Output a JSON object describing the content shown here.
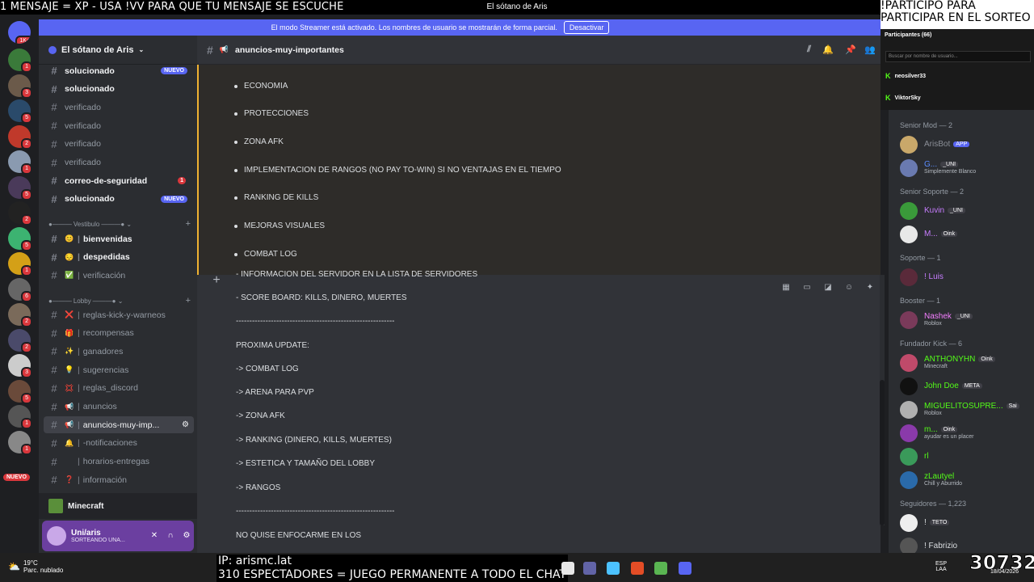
{
  "overlay": {
    "marquee": "1 MENSAJE = XP - USA !VV PARA QUE TU MENSAJE SE ESCUCHE",
    "window_title": "El sótano de Aris",
    "right_text": "!PARTICIPO PARA PARTICIPAR EN EL SORTEO",
    "ip": "IP: arismc.lat",
    "spectators": "310 ESPECTADORES = JUEGO PERMANENTE A TODO EL CHAT",
    "viewer_count": "30732"
  },
  "banner": {
    "text": "El modo Streamer está activado. Los nombres de usuario se mostrarán de forma parcial.",
    "button": "Desactivar"
  },
  "rail": {
    "home_badge": "1K+",
    "badges": [
      "1",
      "3",
      "5",
      "2",
      "1",
      "5",
      "2",
      "5",
      "1",
      "6",
      "2",
      "2",
      "3",
      "5",
      "1",
      "1"
    ],
    "new_label": "NUEVO"
  },
  "server": {
    "name": "El sótano de Aris"
  },
  "channels": [
    {
      "name": "solucionado",
      "unread": true,
      "badge": "NUEVO"
    },
    {
      "name": "solucionado",
      "unread": true
    },
    {
      "name": "verificado"
    },
    {
      "name": "verificado"
    },
    {
      "name": "verificado"
    },
    {
      "name": "verificado"
    },
    {
      "name": "correo-de-seguridad",
      "unread": true,
      "count": "1"
    },
    {
      "name": "solucionado",
      "unread": true,
      "badge": "NUEVO"
    }
  ],
  "category_vestibulo": "Vestibulo",
  "vestibulo_channels": [
    {
      "emoji": "😊",
      "name": "bienvenidas"
    },
    {
      "emoji": "😔",
      "name": "despedidas"
    },
    {
      "emoji": "✅",
      "name": "verificación"
    }
  ],
  "category_lobby": "Lobby",
  "lobby_channels": [
    {
      "emoji": "❌",
      "name": "reglas-kick-y-warneos"
    },
    {
      "emoji": "🎁",
      "name": "recompensas"
    },
    {
      "emoji": "✨",
      "name": "ganadores"
    },
    {
      "emoji": "💡",
      "name": "sugerencias"
    },
    {
      "emoji": "💢",
      "name": "reglas_discord"
    },
    {
      "emoji": "📢",
      "name": "anuncios"
    },
    {
      "emoji": "📢",
      "name": "anuncios-muy-imp..."
    },
    {
      "emoji": "🔔",
      "name": "-notificaciones"
    },
    {
      "emoji": "",
      "name": "horarios-entregas"
    },
    {
      "emoji": "❓",
      "name": "información"
    }
  ],
  "voice": {
    "name": "Minecraft"
  },
  "user": {
    "name": "Uni/aris",
    "status": "SORTEANDO UNA..."
  },
  "channel_header": {
    "name": "anuncios-muy-importantes"
  },
  "thread_bullets": [
    "ECONOMIA",
    "PROTECCIONES",
    "ZONA AFK",
    "IMPLEMENTACION DE RANGOS (NO PAY TO-WIN) SI NO VENTAJAS EN EL TIEMPO",
    "RANKING DE KILLS",
    "MEJORAS VISUALES",
    "COMBAT LOG"
  ],
  "messages": [
    "- INFORMACION DEL SERVIDOR EN LA LISTA DE SERVIDORES",
    "- SCORE BOARD: KILLS, DINERO, MUERTES",
    "-----------------------------------------------------------",
    "PROXIMA UPDATE:",
    "-> COMBAT LOG",
    "-> ARENA PARA PVP",
    "-> ZONA AFK",
    "-> RANKING (DINERO, KILLS, MUERTES)",
    "-> ESTETICA Y TAMAÑO DEL LOBBY",
    "-> RANGOS",
    "-----------------------------------------------------------",
    "NO QUISE ENFOCARME EN LOS"
  ],
  "participants": {
    "title": "Participantes (66)",
    "search_placeholder": "Buscar por nombre de usuario...",
    "list": [
      "neosilver33",
      "ViktorSky"
    ]
  },
  "member_groups": [
    {
      "title": "Senior Mod — 2",
      "members": [
        {
          "name": "ArisBot",
          "tag": "APP",
          "color": "#8b8f97",
          "sub": ""
        },
        {
          "name": "G...",
          "tag": "_UNI",
          "color": "#5b8cff",
          "sub": "Simplemente Blanco"
        }
      ]
    },
    {
      "title": "Senior Soporte — 2",
      "members": [
        {
          "name": "Kuvin",
          "tag": "_UNI",
          "color": "#c77dff",
          "sub": ""
        },
        {
          "name": "M...",
          "tag": "Oink",
          "color": "#c77dff",
          "sub": ""
        }
      ]
    },
    {
      "title": "Soporte — 1",
      "members": [
        {
          "name": "! Luis",
          "tag": "",
          "color": "#c77dff",
          "sub": ""
        }
      ]
    },
    {
      "title": "Booster — 1",
      "members": [
        {
          "name": "Nashek",
          "tag": "_UNI",
          "color": "#f47fff",
          "sub": "Roblox"
        }
      ]
    },
    {
      "title": "Fundador Kick — 6",
      "members": [
        {
          "name": "ANTHONYHN",
          "tag": "Oink",
          "color": "#53fc18",
          "sub": "Minecraft"
        },
        {
          "name": "John Doe",
          "tag": "META",
          "color": "#53fc18",
          "sub": ""
        },
        {
          "name": "MIGUELITOSUPRE...",
          "tag": "Sai",
          "color": "#53fc18",
          "sub": "Roblox"
        },
        {
          "name": "m...",
          "tag": "Oink",
          "color": "#53fc18",
          "sub": "ayudar es un placer"
        },
        {
          "name": "rl",
          "tag": "",
          "color": "#53fc18",
          "sub": ""
        },
        {
          "name": "zLautyel",
          "tag": "",
          "color": "#53fc18",
          "sub": "Chill y Aburrido"
        }
      ]
    },
    {
      "title": "Seguidores — 1,223",
      "members": [
        {
          "name": "!",
          "tag": "TETO",
          "color": "#dbdee1",
          "sub": ""
        },
        {
          "name": "! Fabrizio",
          "tag": "",
          "color": "#dbdee1",
          "sub": ""
        }
      ]
    }
  ],
  "taskbar": {
    "temp": "19°C",
    "weather": "Parc. nublado",
    "lang": "ESP",
    "lang2": "LAA",
    "date": "18/04/2026"
  }
}
